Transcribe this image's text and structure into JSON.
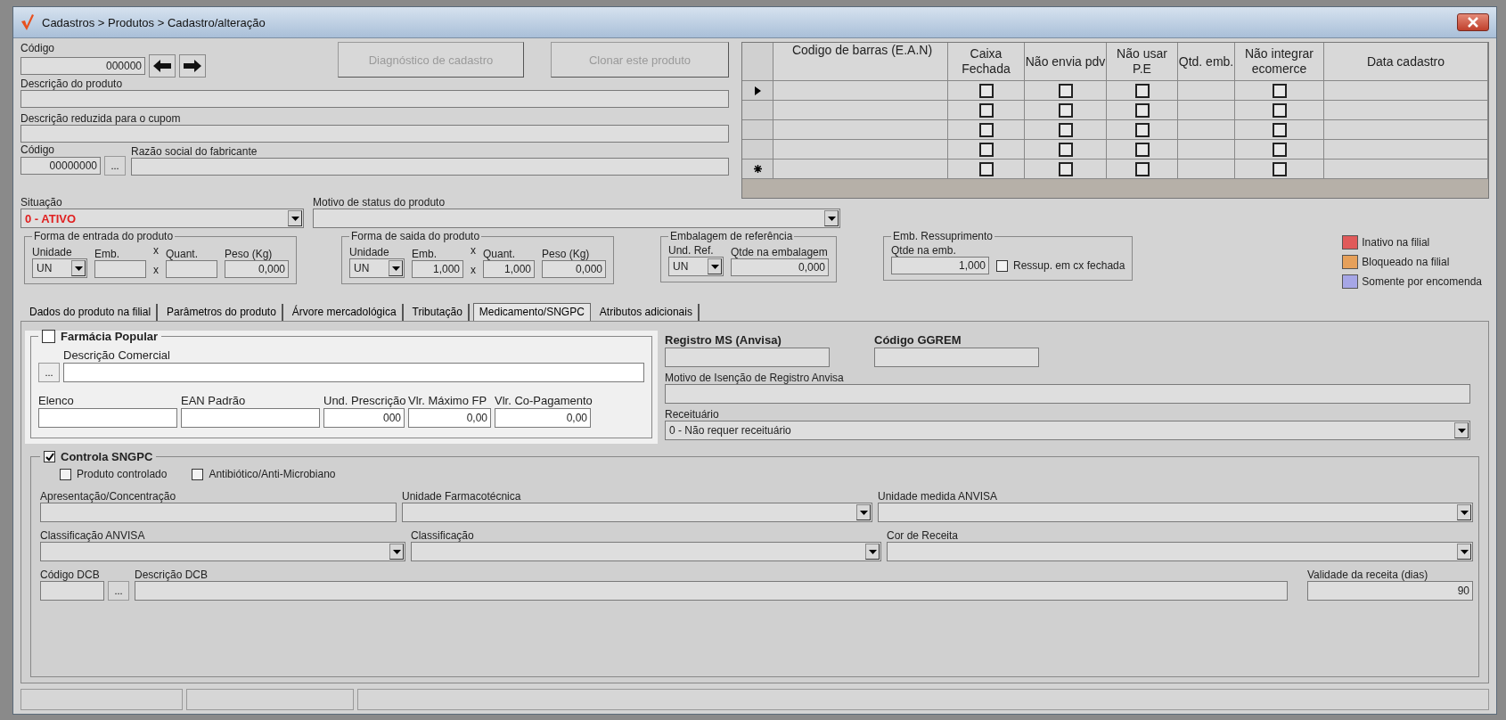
{
  "window": {
    "title": "Cadastros > Produtos > Cadastro/alteração"
  },
  "product": {
    "code_label": "Código",
    "code_value": "000000",
    "actions": [
      {
        "label": "Diagnóstico de cadastro",
        "disabled": true
      },
      {
        "label": "Clonar este produto",
        "disabled": true
      }
    ],
    "description_label": "Descrição  do produto",
    "short_description_label": "Descrição reduzida para o cupom",
    "manufacturer_code_label": "Código",
    "manufacturer_code_value": "00000000",
    "lookup_button": "...",
    "manufacturer_name_label": "Razão social do fabricante",
    "status_label": "Situação",
    "status_value": "0 - ATIVO",
    "status_reason_label": "Motivo de status do produto"
  },
  "barcodes": {
    "columns": [
      {
        "label": "Codigo de barras (E.A.N)",
        "kind": "text"
      },
      {
        "label": "Caixa Fechada",
        "kind": "check"
      },
      {
        "label": "Não envia pdv",
        "kind": "check"
      },
      {
        "label": "Não usar P.E",
        "kind": "check"
      },
      {
        "label": "Qtd. emb.",
        "kind": "text"
      },
      {
        "label": "Não integrar ecomerce",
        "kind": "check"
      },
      {
        "label": "Data cadastro",
        "kind": "text"
      }
    ],
    "rows": [
      {
        "kind": "current",
        "checks": [
          false,
          false,
          false,
          false
        ]
      },
      {
        "kind": "plain",
        "checks": [
          false,
          false,
          false,
          false
        ]
      },
      {
        "kind": "plain",
        "checks": [
          false,
          false,
          false,
          false
        ]
      },
      {
        "kind": "plain",
        "checks": [
          false,
          false,
          false,
          false
        ]
      },
      {
        "kind": "new",
        "checks": [
          false,
          false,
          false,
          false
        ]
      }
    ]
  },
  "groups": [
    {
      "title": "Forma de entrada do produto",
      "items": [
        {
          "kind": "combo",
          "label": "Unidade",
          "value": "UN"
        },
        {
          "kind": "text",
          "label": "Emb."
        },
        {
          "kind": "times",
          "label": "x",
          "value": "x"
        },
        {
          "kind": "text",
          "label": "Quant."
        },
        {
          "kind": "text",
          "label": "Peso (Kg)",
          "value": "0,000"
        }
      ]
    },
    {
      "title": "Forma de saida do produto",
      "items": [
        {
          "kind": "combo",
          "label": "Unidade",
          "value": "UN"
        },
        {
          "kind": "text",
          "label": "Emb.",
          "value": "1,000"
        },
        {
          "kind": "times",
          "label": "x",
          "value": "x"
        },
        {
          "kind": "text",
          "label": "Quant.",
          "value": "1,000"
        },
        {
          "kind": "text",
          "label": "Peso (Kg)",
          "value": "0,000"
        }
      ]
    },
    {
      "title": "Embalagem de referência",
      "items": [
        {
          "kind": "combo",
          "label": "Und. Ref.",
          "value": "UN"
        },
        {
          "kind": "wide",
          "label": "Qtde na embalagem",
          "value": "0,000"
        }
      ]
    },
    {
      "title": "Emb. Ressuprimento",
      "items": [
        {
          "kind": "wide",
          "label": "Qtde na emb.",
          "value": "1,000"
        },
        {
          "kind": "check",
          "label": "Ressup. em cx fechada",
          "checked": false
        }
      ]
    }
  ],
  "legend": [
    {
      "label": "Inativo na filial",
      "color": "#e05a5a"
    },
    {
      "label": "Bloqueado na filial",
      "color": "#e6a05a"
    },
    {
      "label": "Somente por encomenda",
      "color": "#a6a6e6"
    }
  ],
  "tabs": [
    {
      "label": "Dados do produto na filial",
      "selected": false
    },
    {
      "label": "Parâmetros do produto",
      "selected": false
    },
    {
      "label": "Árvore mercadológica",
      "selected": false
    },
    {
      "label": "Tributação",
      "selected": false
    },
    {
      "label": "Medicamento/SNGPC",
      "selected": true
    },
    {
      "label": "Atributos adicionais",
      "selected": false
    }
  ],
  "farmacia_popular": {
    "title": "Farmácia Popular",
    "checked": false,
    "lookup_button": "...",
    "description_label": "Descrição Comercial",
    "fields": [
      {
        "label": "Elenco"
      },
      {
        "label": "EAN Padrão"
      },
      {
        "label": "Und. Prescrição",
        "value": "000"
      },
      {
        "label": "Vlr. Máximo FP",
        "value": "0,00"
      },
      {
        "label": "Vlr. Co-Pagamento",
        "value": "0,00"
      }
    ]
  },
  "anvisa": {
    "registro_label": "Registro MS (Anvisa)",
    "ggrem_label": "Código GGREM",
    "exemption_label": "Motivo de Isenção de Registro Anvisa",
    "prescription_label": "Receituário",
    "prescription_value": "0 - Não requer receituário"
  },
  "sngpc": {
    "title": "Controla SNGPC",
    "checked": true,
    "options": [
      {
        "label": "Produto controlado",
        "checked": false
      },
      {
        "label": "Antibiótico/Anti-Microbiano",
        "checked": false
      }
    ],
    "rows": [
      [
        {
          "kind": "text",
          "label": "Apresentação/Concentração"
        },
        {
          "kind": "combo",
          "label": "Unidade Farmacotécnica"
        },
        {
          "kind": "combo",
          "label": "Unidade medida ANVISA"
        }
      ],
      [
        {
          "kind": "combo",
          "label": "Classificação ANVISA"
        },
        {
          "kind": "combo",
          "label": "Classificação"
        },
        {
          "kind": "combo",
          "label": "Cor de  Receita"
        }
      ]
    ],
    "dcb_code_label": "Código DCB",
    "lookup_button": "...",
    "dcb_description_label": "Descrição DCB",
    "validity_label": "Validade da receita (dias)",
    "validity_value": "90"
  }
}
